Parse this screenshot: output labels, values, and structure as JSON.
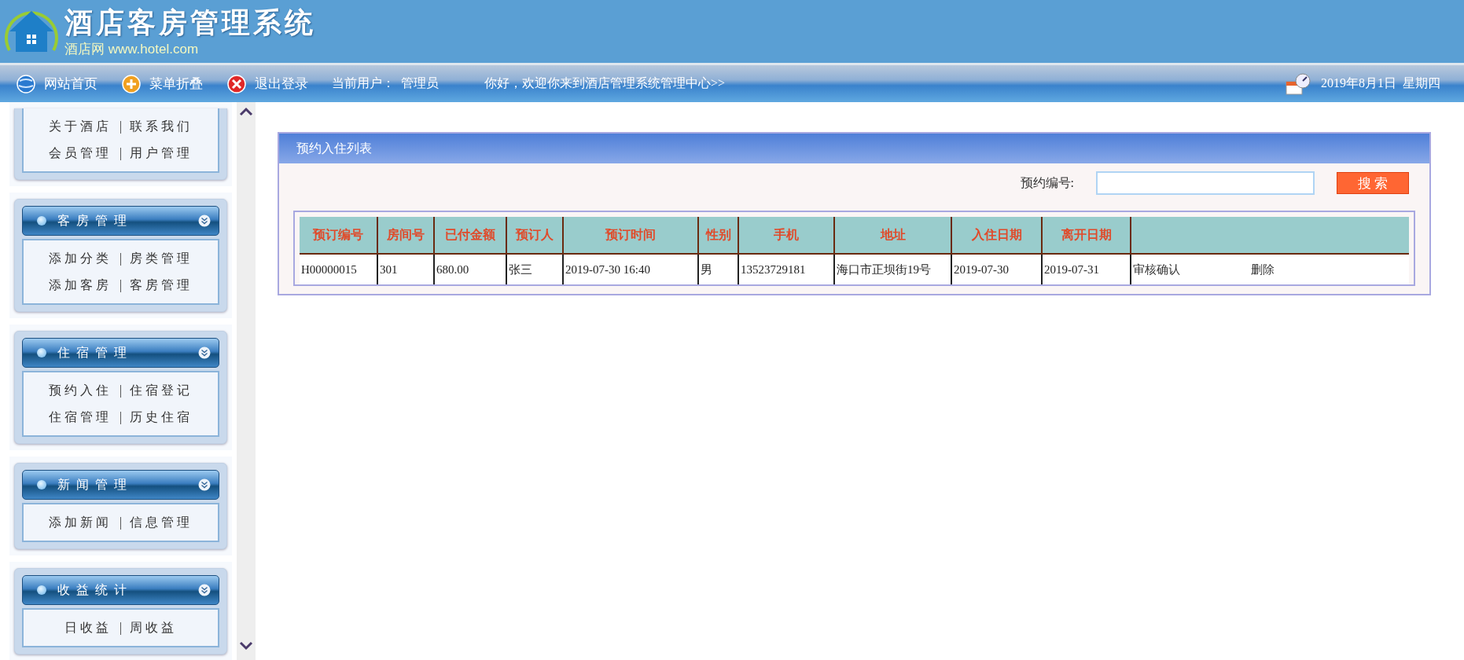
{
  "header": {
    "title": "酒店客房管理系统",
    "subtitle": "酒店网 www.hotel.com"
  },
  "nav": {
    "items": [
      {
        "kind": "home",
        "label": "网站首页"
      },
      {
        "kind": "collapse",
        "label": "菜单折叠"
      },
      {
        "kind": "logout",
        "label": "退出登录"
      }
    ],
    "current_user_label": "当前用户：",
    "current_user": "管理员",
    "welcome": "你好，欢迎你来到酒店管理系统管理中心>>",
    "date": "2019年8月1日  星期四"
  },
  "sidebar": {
    "groups": [
      {
        "rows": [
          [
            {
              "kind": "link",
              "text": "关于酒店"
            },
            {
              "kind": "sep",
              "text": "|"
            },
            {
              "kind": "link",
              "text": "联系我们"
            }
          ],
          [
            {
              "kind": "link",
              "text": "会员管理"
            },
            {
              "kind": "sep",
              "text": "|"
            },
            {
              "kind": "link",
              "text": "用户管理"
            }
          ]
        ]
      },
      {
        "title": "客房管理",
        "rows": [
          [
            {
              "kind": "link",
              "text": "添加分类"
            },
            {
              "kind": "sep",
              "text": "|"
            },
            {
              "kind": "link",
              "text": "房类管理"
            }
          ],
          [
            {
              "kind": "link",
              "text": "添加客房"
            },
            {
              "kind": "sep",
              "text": "|"
            },
            {
              "kind": "link",
              "text": "客房管理"
            }
          ]
        ]
      },
      {
        "title": "住宿管理",
        "rows": [
          [
            {
              "kind": "link",
              "text": "预约入住"
            },
            {
              "kind": "sep",
              "text": "|"
            },
            {
              "kind": "link",
              "text": "住宿登记"
            }
          ],
          [
            {
              "kind": "link",
              "text": "住宿管理"
            },
            {
              "kind": "sep",
              "text": "|"
            },
            {
              "kind": "link",
              "text": "历史住宿"
            }
          ]
        ]
      },
      {
        "title": "新闻管理",
        "rows": [
          [
            {
              "kind": "link",
              "text": "添加新闻"
            },
            {
              "kind": "sep",
              "text": "|"
            },
            {
              "kind": "link",
              "text": "信息管理"
            }
          ]
        ]
      },
      {
        "title": "收益统计",
        "rows": [
          [
            {
              "kind": "link",
              "text": "日收益"
            },
            {
              "kind": "sep",
              "text": "|"
            },
            {
              "kind": "link",
              "text": "周收益"
            }
          ]
        ]
      }
    ]
  },
  "panel": {
    "title": "预约入住列表",
    "search": {
      "label": "预约编号:",
      "button": "搜 索"
    },
    "table": {
      "columns": [
        "预订编号",
        "房间号",
        "已付金额",
        "预订人",
        "预订时间",
        "性别",
        "手机",
        "地址",
        "入住日期",
        "离开日期"
      ],
      "rows": [
        {
          "cells": [
            "H00000015",
            "301",
            "680.00",
            "张三",
            "2019-07-30 16:40",
            "男",
            "13523729181",
            "海口市正坝街19号",
            "2019-07-30",
            "2019-07-31"
          ],
          "actions": [
            "审核确认",
            "删除"
          ]
        }
      ]
    }
  }
}
